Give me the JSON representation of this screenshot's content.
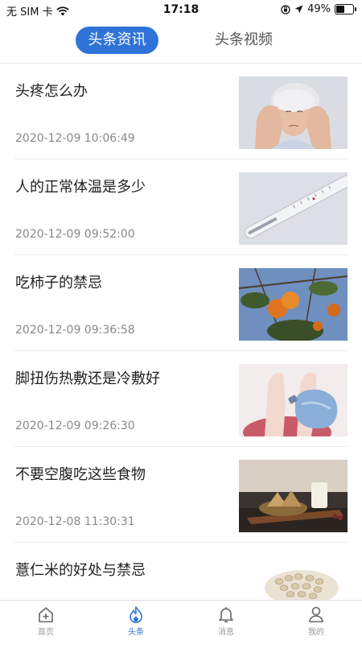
{
  "status": {
    "carrier": "无 SIM 卡",
    "time": "17:18",
    "battery": "49%",
    "battery_level": 0.49
  },
  "tabs": [
    {
      "label": "头条资讯",
      "active": true
    },
    {
      "label": "头条视频",
      "active": false
    }
  ],
  "articles": [
    {
      "title": "头疼怎么办",
      "date": "2020-12-09 10:06:49",
      "image": "elderly-woman-headache"
    },
    {
      "title": "人的正常体温是多少",
      "date": "2020-12-09 09:52:00",
      "image": "thermometer"
    },
    {
      "title": "吃柿子的禁忌",
      "date": "2020-12-09 09:36:58",
      "image": "persimmons-on-tree"
    },
    {
      "title": "脚扭伤热敷还是冷敷好",
      "date": "2020-12-09 09:26:30",
      "image": "ice-pack-on-ankle"
    },
    {
      "title": "不要空腹吃这些食物",
      "date": "2020-12-08 11:30:31",
      "image": "zongzi-and-milk"
    },
    {
      "title": "薏仁米的好处与禁忌",
      "date": "",
      "image": "coix-seeds"
    }
  ],
  "bottom_nav": [
    {
      "label": "首页",
      "icon": "home-plus-icon",
      "active": false
    },
    {
      "label": "头条",
      "icon": "flame-icon",
      "active": true
    },
    {
      "label": "消息",
      "icon": "bell-icon",
      "active": false
    },
    {
      "label": "我的",
      "icon": "person-icon",
      "active": false
    }
  ],
  "colors": {
    "accent": "#2f73d9",
    "inactive": "#999999"
  }
}
